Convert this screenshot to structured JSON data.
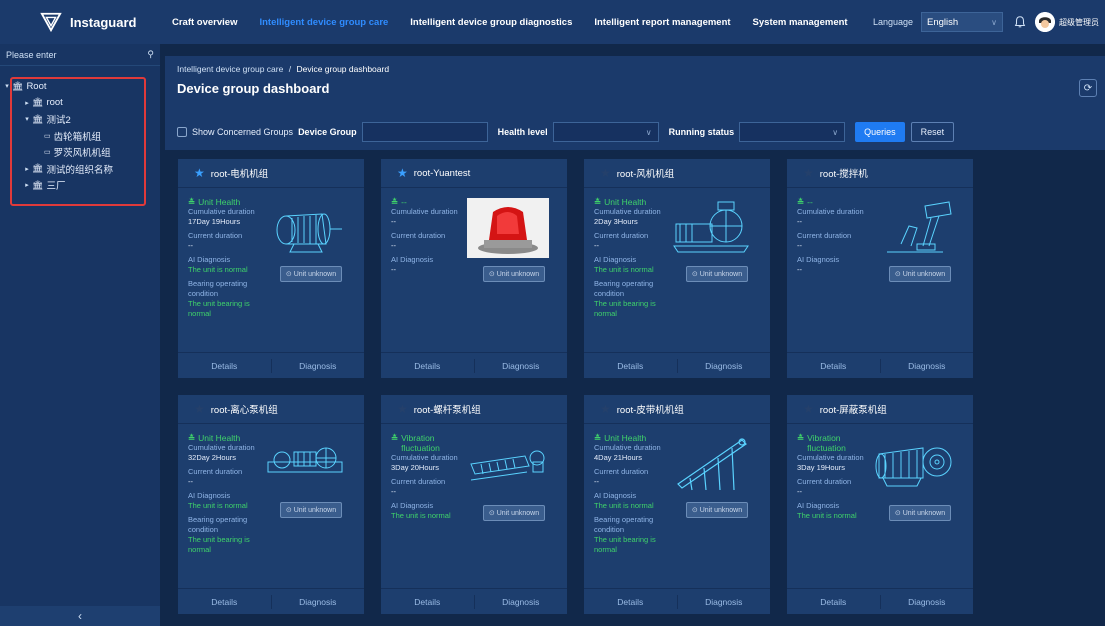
{
  "app": {
    "name": "Instaguard"
  },
  "nav": {
    "items": [
      "Craft overview",
      "Intelligent device group care",
      "Intelligent device group diagnostics",
      "Intelligent report management",
      "System management"
    ],
    "active_index": 1,
    "language_label": "Language",
    "language_value": "English",
    "user_name": "超级管理员"
  },
  "sidebar": {
    "search_placeholder": "Please enter",
    "tree": [
      {
        "label": "Root",
        "level": 0,
        "icon": "building-icon"
      },
      {
        "label": "root",
        "level": 1,
        "icon": "building-icon"
      },
      {
        "label": "测试2",
        "level": 1,
        "icon": "building-icon"
      },
      {
        "label": "齿轮箱机组",
        "level": 2,
        "icon": "device-icon"
      },
      {
        "label": "罗茨风机机组",
        "level": 2,
        "icon": "device-icon"
      },
      {
        "label": "测试的组织名称",
        "level": 1,
        "icon": "building-icon"
      },
      {
        "label": "三厂",
        "level": 1,
        "icon": "building-icon"
      }
    ],
    "collapse_label": "‹"
  },
  "main": {
    "breadcrumb_parent": "Intelligent device group care",
    "breadcrumb_sep": "/",
    "breadcrumb_current": "Device group dashboard",
    "title": "Device group dashboard",
    "filters": {
      "show_concerned_label": "Show Concerned Groups",
      "device_group_label": "Device Group",
      "health_level_label": "Health level",
      "running_status_label": "Running status",
      "query_label": "Queries",
      "reset_label": "Reset"
    }
  },
  "cards": [
    {
      "title": "root-电机机组",
      "starred": true,
      "health": "Unit Health",
      "cum_label": "Cumulative duration",
      "cum_value": "17Day 19Hours",
      "cur_label": "Current duration",
      "cur_value": "--",
      "ai_label": "AI Diagnosis",
      "ai_value": "The unit is normal",
      "bearing_label": "Bearing operating condition",
      "bearing_value": "The unit bearing is normal",
      "unit_btn": "Unit unknown",
      "details": "Details",
      "diagnosis": "Diagnosis",
      "illus": "motor"
    },
    {
      "title": "root-Yuantest",
      "starred": true,
      "health": "--",
      "cum_label": "Cumulative duration",
      "cum_value": "--",
      "cur_label": "Current duration",
      "cur_value": "--",
      "ai_label": "AI Diagnosis",
      "ai_value": "--",
      "bearing_label": "",
      "bearing_value": "",
      "unit_btn": "Unit unknown",
      "details": "Details",
      "diagnosis": "Diagnosis",
      "illus": "alarm"
    },
    {
      "title": "root-风机机组",
      "starred": false,
      "health": "Unit Health",
      "cum_label": "Cumulative duration",
      "cum_value": "2Day 3Hours",
      "cur_label": "Current duration",
      "cur_value": "--",
      "ai_label": "AI Diagnosis",
      "ai_value": "The unit is normal",
      "bearing_label": "Bearing operating condition",
      "bearing_value": "The unit bearing is normal",
      "unit_btn": "Unit unknown",
      "details": "Details",
      "diagnosis": "Diagnosis",
      "illus": "fan"
    },
    {
      "title": "root-搅拌机",
      "starred": false,
      "health": "--",
      "cum_label": "Cumulative duration",
      "cum_value": "--",
      "cur_label": "Current duration",
      "cur_value": "--",
      "ai_label": "AI Diagnosis",
      "ai_value": "--",
      "bearing_label": "",
      "bearing_value": "",
      "unit_btn": "Unit unknown",
      "details": "Details",
      "diagnosis": "Diagnosis",
      "illus": "mixer"
    },
    {
      "title": "root-离心泵机组",
      "starred": false,
      "health": "Unit Health",
      "cum_label": "Cumulative duration",
      "cum_value": "32Day 2Hours",
      "cur_label": "Current duration",
      "cur_value": "--",
      "ai_label": "AI Diagnosis",
      "ai_value": "The unit is normal",
      "bearing_label": "Bearing operating condition",
      "bearing_value": "The unit bearing is normal",
      "unit_btn": "Unit unknown",
      "details": "Details",
      "diagnosis": "Diagnosis",
      "illus": "pump"
    },
    {
      "title": "root-螺杆泵机组",
      "starred": false,
      "health": "Vibration fluctuation",
      "cum_label": "Cumulative duration",
      "cum_value": "3Day 20Hours",
      "cur_label": "Current duration",
      "cur_value": "--",
      "ai_label": "AI Diagnosis",
      "ai_value": "The unit is normal",
      "bearing_label": "",
      "bearing_value": "",
      "unit_btn": "Unit unknown",
      "details": "Details",
      "diagnosis": "Diagnosis",
      "illus": "screw"
    },
    {
      "title": "root-皮带机机组",
      "starred": false,
      "health": "Unit Health",
      "cum_label": "Cumulative duration",
      "cum_value": "4Day 21Hours",
      "cur_label": "Current duration",
      "cur_value": "--",
      "ai_label": "AI Diagnosis",
      "ai_value": "The unit is normal",
      "bearing_label": "Bearing operating condition",
      "bearing_value": "The unit bearing is normal",
      "unit_btn": "Unit unknown",
      "details": "Details",
      "diagnosis": "Diagnosis",
      "illus": "belt"
    },
    {
      "title": "root-屏蔽泵机组",
      "starred": false,
      "health": "Vibration fluctuation",
      "cum_label": "Cumulative duration",
      "cum_value": "3Day 19Hours",
      "cur_label": "Current duration",
      "cur_value": "--",
      "ai_label": "AI Diagnosis",
      "ai_value": "The unit is normal",
      "bearing_label": "",
      "bearing_value": "",
      "unit_btn": "Unit unknown",
      "details": "Details",
      "diagnosis": "Diagnosis",
      "illus": "canned"
    }
  ],
  "colors": {
    "accent": "#2f8cff",
    "healthy": "#3fd36a",
    "alert_box": "#e03a3a"
  }
}
